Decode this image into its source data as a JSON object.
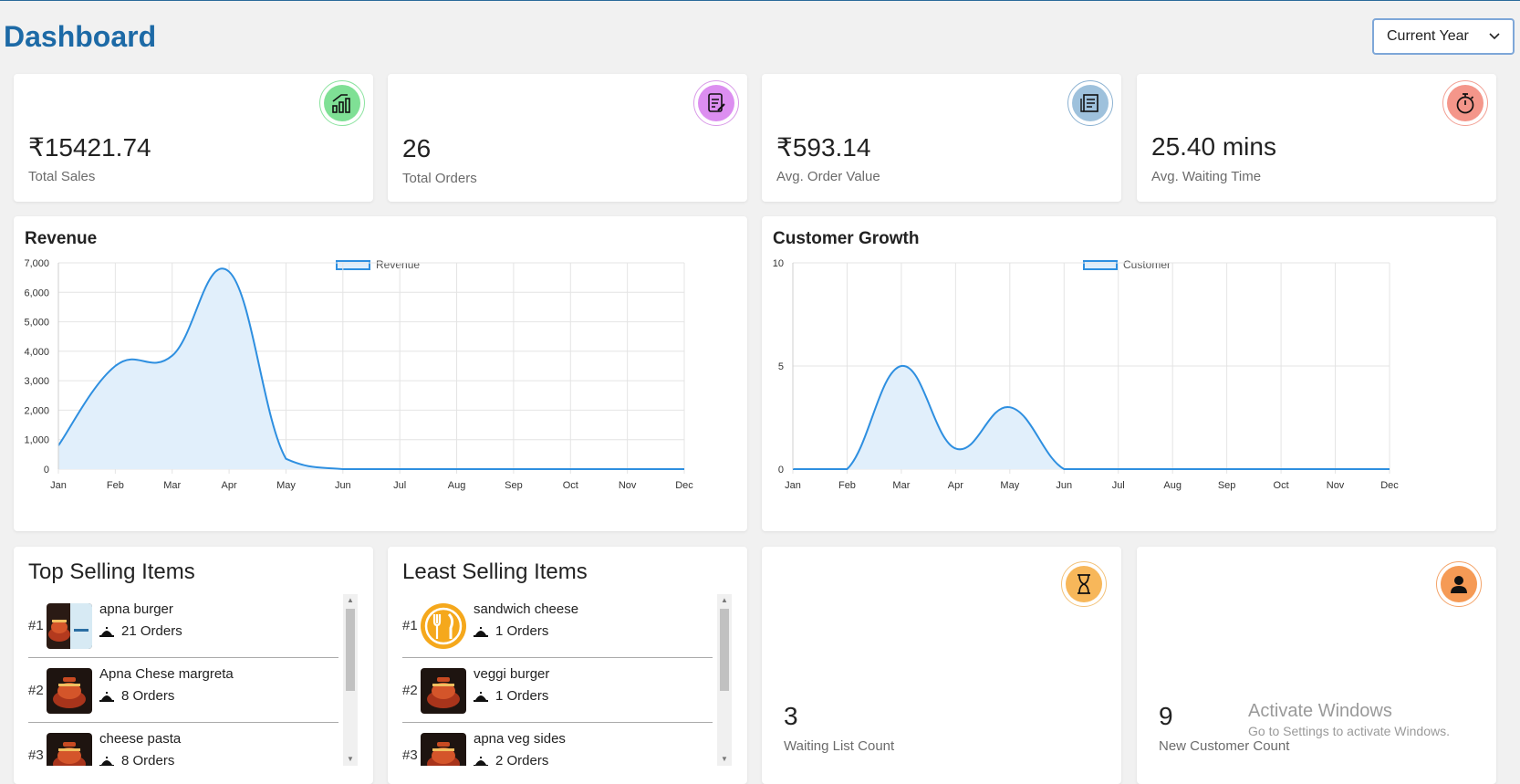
{
  "header": {
    "title": "Dashboard",
    "period_select": "Current Year"
  },
  "stats": [
    {
      "value": "₹15421.74",
      "label": "Total Sales",
      "icon": "bar-chart-up-icon",
      "color": "#27b04b"
    },
    {
      "value": "26",
      "label": "Total Orders",
      "icon": "order-edit-icon",
      "color": "#a23ec7"
    },
    {
      "value": "₹593.14",
      "label": "Avg. Order Value",
      "icon": "receipt-icon",
      "color": "#3b7fb4"
    },
    {
      "value": "25.40 mins",
      "label": "Avg. Waiting Time",
      "icon": "stopwatch-icon",
      "color": "#e04a3a"
    }
  ],
  "chart_data": [
    {
      "type": "area",
      "title": "Revenue",
      "series": [
        {
          "name": "Revenue",
          "values": [
            800,
            3500,
            3850,
            6700,
            350,
            0,
            0,
            0,
            0,
            0,
            0,
            0
          ]
        }
      ],
      "categories": [
        "Jan",
        "Feb",
        "Mar",
        "Apr",
        "May",
        "Jun",
        "Jul",
        "Aug",
        "Sep",
        "Oct",
        "Nov",
        "Dec"
      ],
      "yticks": [
        "0",
        "1,000",
        "2,000",
        "3,000",
        "4,000",
        "5,000",
        "6,000",
        "7,000"
      ],
      "ylim": [
        0,
        7000
      ],
      "grid": true,
      "legend": "top-center",
      "color": "#2e8fe0"
    },
    {
      "type": "area",
      "title": "Customer Growth",
      "series": [
        {
          "name": "Customer",
          "values": [
            0,
            0,
            5,
            1,
            3,
            0,
            0,
            0,
            0,
            0,
            0,
            0
          ]
        }
      ],
      "categories": [
        "Jan",
        "Feb",
        "Mar",
        "Apr",
        "May",
        "Jun",
        "Jul",
        "Aug",
        "Sep",
        "Oct",
        "Nov",
        "Dec"
      ],
      "yticks": [
        "0",
        "5",
        "10"
      ],
      "ylim": [
        0,
        10
      ],
      "grid": true,
      "legend": "top-center",
      "color": "#2e8fe0"
    }
  ],
  "top_selling": {
    "title": "Top Selling Items",
    "items": [
      {
        "rank": "#1",
        "name": "apna burger",
        "orders": "21 Orders",
        "image": "food-photo"
      },
      {
        "rank": "#2",
        "name": "Apna Chese margreta",
        "orders": "8 Orders",
        "image": "food-photo"
      },
      {
        "rank": "#3",
        "name": "cheese pasta",
        "orders": "8 Orders",
        "image": "food-photo"
      }
    ]
  },
  "least_selling": {
    "title": "Least Selling Items",
    "items": [
      {
        "rank": "#1",
        "name": "sandwich cheese",
        "orders": "1 Orders",
        "image": "fork-knife-icon"
      },
      {
        "rank": "#2",
        "name": "veggi burger",
        "orders": "1 Orders",
        "image": "food-photo"
      },
      {
        "rank": "#3",
        "name": "apna veg sides",
        "orders": "2 Orders",
        "image": "food-photo"
      }
    ]
  },
  "waiting": {
    "value": "3",
    "label": "Waiting List Count",
    "icon": "hourglass-icon",
    "color": "#f0a030"
  },
  "customers": {
    "value": "9",
    "label": "New Customer Count",
    "icon": "user-icon",
    "color": "#f07a20"
  },
  "watermark": {
    "title": "Activate Windows",
    "subtitle": "Go to Settings to activate Windows."
  }
}
